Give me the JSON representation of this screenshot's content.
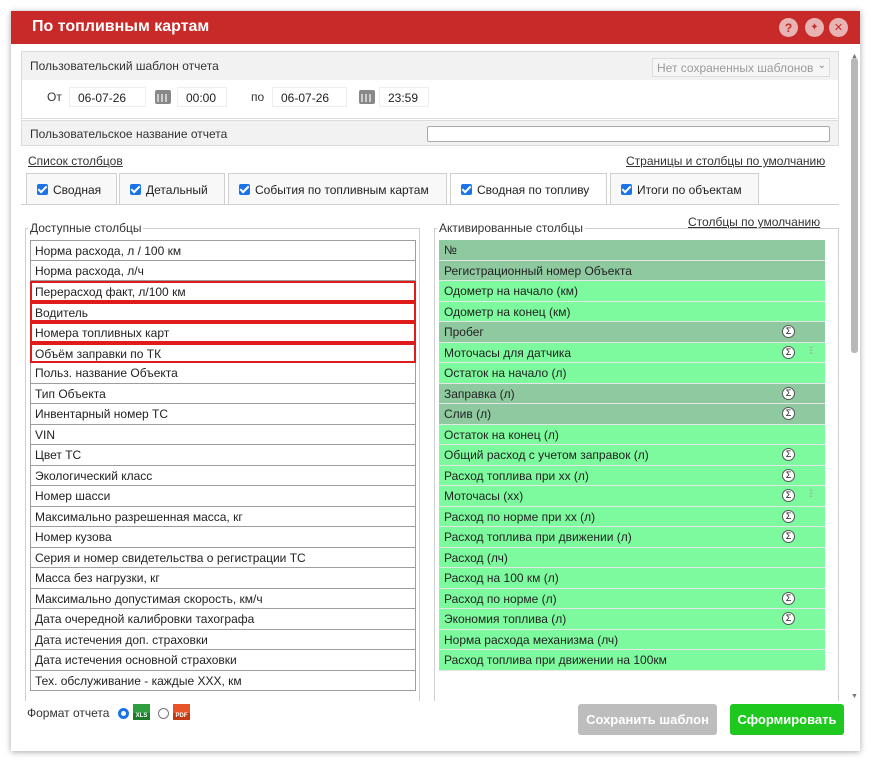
{
  "window": {
    "title": "По топливным картам",
    "buttons": {
      "help": "?",
      "options": "✦",
      "close": "✕"
    }
  },
  "template": {
    "label": "Пользовательский шаблон отчета",
    "select_value": "Нет сохраненных шаблонов"
  },
  "interval": {
    "from_label": "От",
    "from_date": "06-07-26",
    "from_time": "00:00",
    "to_label": "по",
    "to_date": "06-07-26",
    "to_time": "23:59"
  },
  "report_name": {
    "label": "Пользовательское название отчета",
    "value": ""
  },
  "links": {
    "columns_list": "Список столбцов",
    "defaults": "Страницы и столбцы по умолчанию",
    "columns_default": "Столбцы по умолчанию"
  },
  "tabs": [
    {
      "label": "Сводная",
      "checked": true
    },
    {
      "label": "Детальный",
      "checked": true
    },
    {
      "label": "События по топливным картам",
      "checked": true
    },
    {
      "label": "Сводная по топливу",
      "checked": true,
      "active": true
    },
    {
      "label": "Итоги по объектам",
      "checked": true
    }
  ],
  "available": {
    "legend": "Доступные столбцы",
    "items": [
      "Норма расхода, л / 100 км",
      "Норма расхода, л/ч",
      "Перерасход факт, л/100 км",
      "Водитель",
      "Номера топливных карт",
      "Объём заправки по ТК",
      "Польз. название Объекта",
      "Тип Объекта",
      "Инвентарный номер ТС",
      "VIN",
      "Цвет ТС",
      "Экологический класс",
      "Номер шасси",
      "Максимально разрешенная масса, кг",
      "Номер кузова",
      "Серия и номер свидетельства о регистрации ТС",
      "Масса без нагрузки, кг",
      "Максимально допустимая скорость, км/ч",
      "Дата очередной калибровки тахографа",
      "Дата истечения доп. страховки",
      "Дата истечения основной страховки",
      "Тех. обслуживание - каждые XXX, км"
    ],
    "highlighted": [
      2,
      3,
      4,
      5
    ]
  },
  "activated": {
    "legend": "Активированные столбцы",
    "items": [
      {
        "label": "№",
        "style": "grey"
      },
      {
        "label": "Регистрационный номер Объекта",
        "style": "grey"
      },
      {
        "label": "Одометр на начало (км)",
        "style": "green"
      },
      {
        "label": "Одометр на конец (км)",
        "style": "green"
      },
      {
        "label": "Пробег",
        "style": "grey",
        "sigma": true
      },
      {
        "label": "Моточасы для датчика",
        "style": "green",
        "sigma": true,
        "sliders": true
      },
      {
        "label": "Остаток на начало (л)",
        "style": "green"
      },
      {
        "label": "Заправка (л)",
        "style": "grey",
        "sigma": true
      },
      {
        "label": "Слив (л)",
        "style": "grey",
        "sigma": true
      },
      {
        "label": "Остаток на конец (л)",
        "style": "green"
      },
      {
        "label": "Общий расход с учетом заправок (л)",
        "style": "green",
        "sigma": true
      },
      {
        "label": "Расход топлива при хх (л)",
        "style": "green",
        "sigma": true
      },
      {
        "label": "Моточасы (хх)",
        "style": "green",
        "sigma": true,
        "sliders": true
      },
      {
        "label": "Расход по норме при хх (л)",
        "style": "green",
        "sigma": true
      },
      {
        "label": "Расход топлива при движении (л)",
        "style": "green",
        "sigma": true
      },
      {
        "label": "Расход (лч)",
        "style": "green"
      },
      {
        "label": "Расход на 100 км (л)",
        "style": "green"
      },
      {
        "label": "Расход по норме (л)",
        "style": "green",
        "sigma": true
      },
      {
        "label": "Экономия топлива (л)",
        "style": "green",
        "sigma": true
      },
      {
        "label": "Норма расхода механизма (лч)",
        "style": "green"
      },
      {
        "label": "Расход топлива при движении на 100км",
        "style": "green"
      }
    ],
    "sigma_symbol": "Σ",
    "sliders_symbol": "⫶⫶"
  },
  "footer": {
    "format_label": "Формат отчета",
    "formats": [
      {
        "name": "XLS",
        "selected": true,
        "color": "#2e9e3e"
      },
      {
        "name": "PDF",
        "selected": false,
        "color": "#e8542a"
      }
    ],
    "save_button": "Сохранить шаблон",
    "generate_button": "Сформировать"
  },
  "colors": {
    "titlebar": "#c82a2a",
    "highlight_border": "#e01b1b",
    "activated_grey": "#8fc9a0",
    "activated_green": "#7dfa9e",
    "generate_button": "#1ec81e",
    "save_button_disabled": "#bdbdbd"
  }
}
